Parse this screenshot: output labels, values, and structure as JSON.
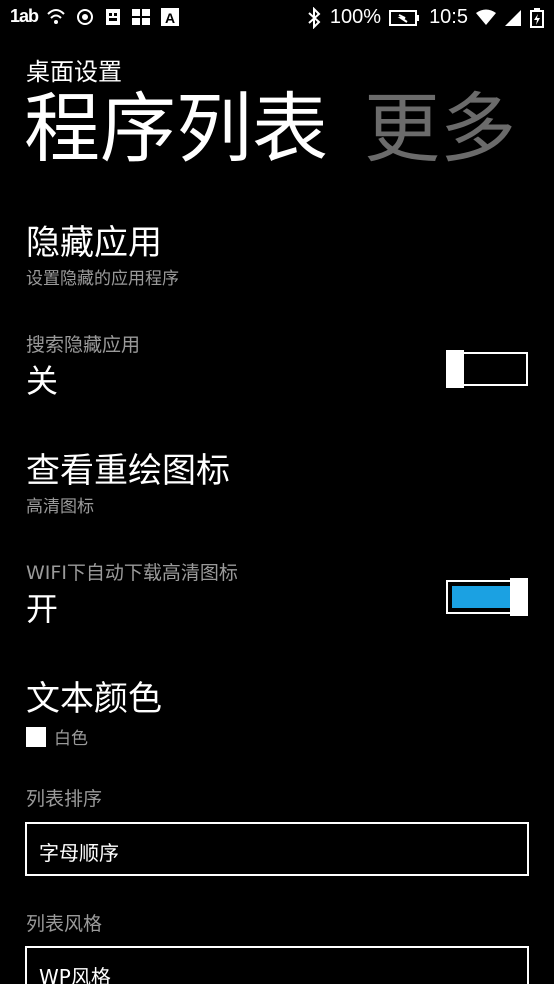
{
  "status_bar": {
    "signal_text": "1ab",
    "battery_percent": "100%",
    "time": "10:5",
    "icons": [
      "wifi-icon",
      "nfc-icon",
      "sim-icon",
      "grid-icon",
      "a-icon",
      "bluetooth-icon",
      "battery-icon",
      "wifi-signal-icon",
      "cell-signal-icon",
      "charging-icon"
    ]
  },
  "header": {
    "app_title": "桌面设置",
    "pivot": [
      {
        "label": "程序列表",
        "active": true
      },
      {
        "label": "更多",
        "active": false
      }
    ]
  },
  "settings": {
    "hidden_apps": {
      "title": "隐藏应用",
      "subtitle": "设置隐藏的应用程序"
    },
    "search_hidden": {
      "label": "搜索隐藏应用",
      "value": "关",
      "toggle_on": false
    },
    "redrawn_icons": {
      "title": "查看重绘图标",
      "subtitle": "高清图标"
    },
    "wifi_download": {
      "label": "WIFI下自动下载高清图标",
      "value": "开",
      "toggle_on": true
    },
    "text_color": {
      "title": "文本颜色",
      "color_name": "白色",
      "color": "#ffffff"
    },
    "list_sort": {
      "label": "列表排序",
      "value": "字母顺序"
    },
    "list_style": {
      "label": "列表风格",
      "value": "WP风格"
    }
  },
  "colors": {
    "accent": "#1ba1e2",
    "dim_text": "#9a9a9a",
    "inactive_pivot": "#6b6b6b"
  }
}
